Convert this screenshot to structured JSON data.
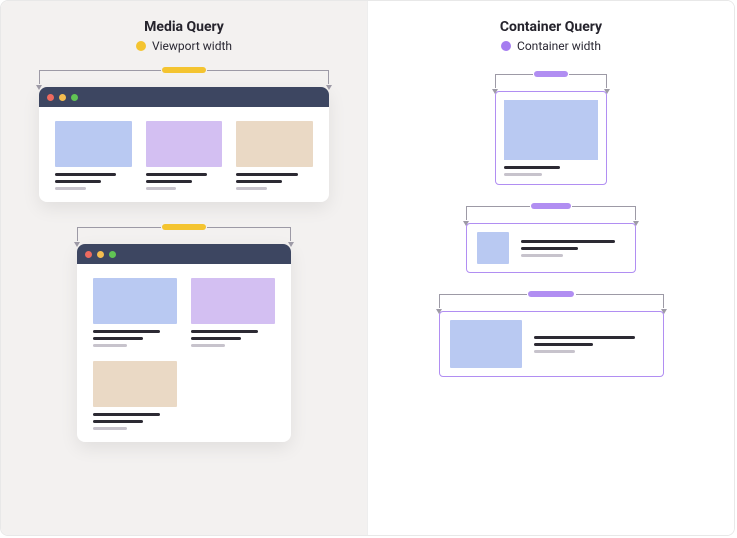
{
  "left": {
    "title": "Media Query",
    "legend_label": "Viewport width",
    "legend_color": "#f4c430"
  },
  "right": {
    "title": "Container Query",
    "legend_label": "Container width",
    "legend_color": "#a57df0"
  },
  "cards": {
    "colors": {
      "blue": "#b9c9f2",
      "lilac": "#d3bff2",
      "beige": "#ead9c5"
    }
  },
  "titlebar_color": "#3d4661",
  "traffic_lights": [
    "#ee6a5f",
    "#f4bd50",
    "#61c454"
  ]
}
